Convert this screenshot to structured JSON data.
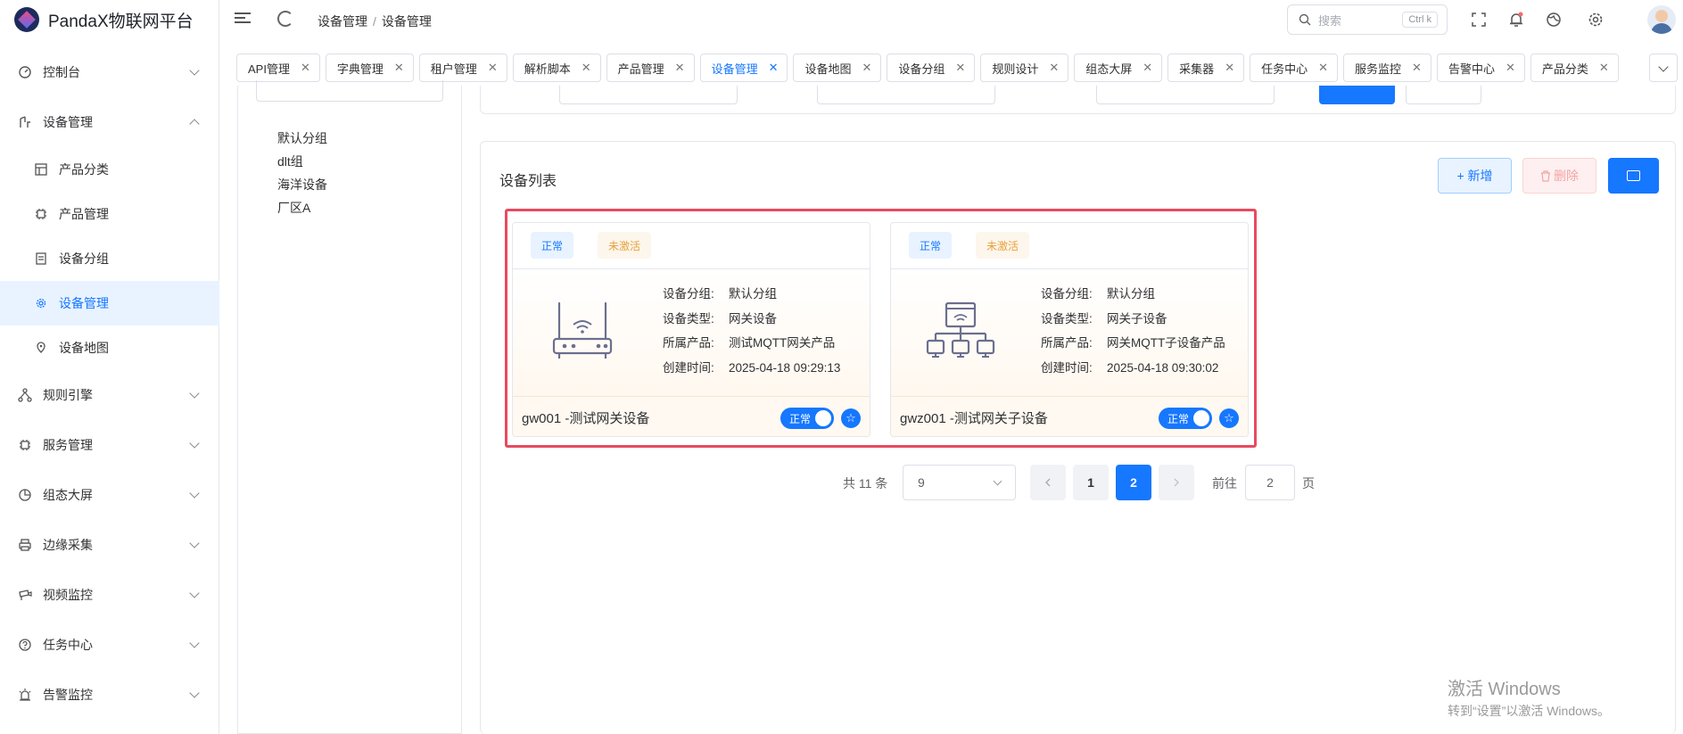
{
  "app": {
    "title": "PandaX物联网平台"
  },
  "sidebar": {
    "items": [
      {
        "label": "控制台",
        "icon": "dashboard-icon"
      },
      {
        "label": "设备管理",
        "icon": "device-icon",
        "expanded": true,
        "children": [
          {
            "label": "产品分类",
            "icon": "grid-icon"
          },
          {
            "label": "产品管理",
            "icon": "chip-icon"
          },
          {
            "label": "设备分组",
            "icon": "document-icon"
          },
          {
            "label": "设备管理",
            "icon": "gear-icon",
            "active": true
          },
          {
            "label": "设备地图",
            "icon": "map-icon"
          }
        ]
      },
      {
        "label": "规则引擎",
        "icon": "flow-icon"
      },
      {
        "label": "服务管理",
        "icon": "cpu-icon"
      },
      {
        "label": "组态大屏",
        "icon": "pie-icon"
      },
      {
        "label": "边缘采集",
        "icon": "printer-icon"
      },
      {
        "label": "视频监控",
        "icon": "camera-icon"
      },
      {
        "label": "任务中心",
        "icon": "question-icon"
      },
      {
        "label": "告警监控",
        "icon": "alarm-icon"
      }
    ]
  },
  "header": {
    "breadcrumb": [
      "设备管理",
      "设备管理"
    ],
    "search_placeholder": "搜索",
    "search_shortcut": "Ctrl k"
  },
  "tabs": [
    {
      "label": "API管理"
    },
    {
      "label": "字典管理"
    },
    {
      "label": "租户管理"
    },
    {
      "label": "解析脚本"
    },
    {
      "label": "产品管理"
    },
    {
      "label": "设备管理",
      "active": true
    },
    {
      "label": "设备地图"
    },
    {
      "label": "设备分组"
    },
    {
      "label": "规则设计"
    },
    {
      "label": "组态大屏"
    },
    {
      "label": "采集器"
    },
    {
      "label": "任务中心"
    },
    {
      "label": "服务监控"
    },
    {
      "label": "告警中心"
    },
    {
      "label": "产品分类"
    }
  ],
  "tree": {
    "items": [
      "默认分组",
      "dlt组",
      "海洋设备",
      "厂区A"
    ]
  },
  "main": {
    "title": "设备列表",
    "add_label": "+ 新增",
    "delete_label": "删除"
  },
  "cards": [
    {
      "status_tag": "正常",
      "activation_tag": "未激活",
      "icon": "router-icon",
      "fields": [
        {
          "k": "设备分组:",
          "v": "默认分组"
        },
        {
          "k": "设备类型:",
          "v": "网关设备"
        },
        {
          "k": "所属产品:",
          "v": "测试MQTT网关产品"
        },
        {
          "k": "创建时间:",
          "v": "2025-04-18 09:29:13"
        }
      ],
      "name": "gw001 -测试网关设备",
      "switch_label": "正常",
      "switch_on": true
    },
    {
      "status_tag": "正常",
      "activation_tag": "未激活",
      "icon": "network-topology-icon",
      "fields": [
        {
          "k": "设备分组:",
          "v": "默认分组"
        },
        {
          "k": "设备类型:",
          "v": "网关子设备"
        },
        {
          "k": "所属产品:",
          "v": "网关MQTT子设备产品"
        },
        {
          "k": "创建时间:",
          "v": "2025-04-18 09:30:02"
        }
      ],
      "name": "gwz001 -测试网关子设备",
      "switch_label": "正常",
      "switch_on": true
    }
  ],
  "pagination": {
    "total_label": "共 11 条",
    "page_size": "9",
    "pages": [
      "1",
      "2"
    ],
    "current": "2",
    "goto_label": "前往",
    "goto_value": "2",
    "page_suffix": "页"
  },
  "watermark": {
    "line1": "激活 Windows",
    "line2": "转到“设置”以激活 Windows。"
  }
}
